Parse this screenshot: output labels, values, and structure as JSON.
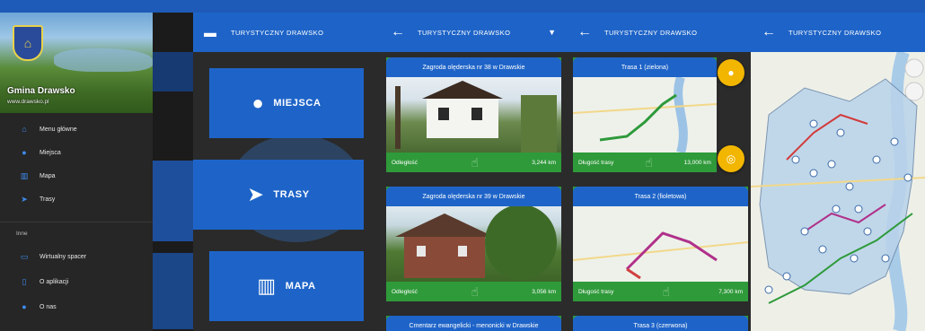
{
  "status_bar": {
    "left": "",
    "right": ""
  },
  "screen1": {
    "drawer": {
      "title": "Gmina Drawsko",
      "subtitle": "www.drawsko.pl",
      "items": [
        {
          "icon": "home-icon",
          "label": "Menu główne"
        },
        {
          "icon": "place-icon",
          "label": "Miejsca"
        },
        {
          "icon": "map-icon",
          "label": "Mapa"
        },
        {
          "icon": "route-icon",
          "label": "Trasy"
        }
      ],
      "section_label": "Inne",
      "other_items": [
        {
          "icon": "cast-icon",
          "label": "Wirtualny spacer"
        },
        {
          "icon": "phone-icon",
          "label": "O aplikacji"
        },
        {
          "icon": "info-icon",
          "label": "O nas"
        }
      ]
    }
  },
  "screen2": {
    "title": "TURYSTYCZNY DRAWSKO",
    "buttons": [
      {
        "icon": "place-icon",
        "label": "MIEJSCA"
      },
      {
        "icon": "navigation-icon",
        "label": "TRASY"
      },
      {
        "icon": "map-icon",
        "label": "MAPA"
      }
    ]
  },
  "screen3": {
    "title": "TURYSTYCZNY DRAWSKO",
    "cards": [
      {
        "title": "Zagroda olęderska nr 38 w Drawskie",
        "foot_label": "Odległość",
        "foot_value": "3,244 km"
      },
      {
        "title": "Zagroda olęderska nr 39 w Drawskie",
        "foot_label": "Odległość",
        "foot_value": "3,056 km"
      },
      {
        "title": "Cmentarz ewangelicki - menonicki w Drawskie"
      }
    ]
  },
  "screen4": {
    "title": "TURYSTYCZNY DRAWSKO",
    "cards": [
      {
        "title": "Trasa 1 (zielona)",
        "foot_label": "Długość trasy",
        "foot_value": "13,000 km"
      },
      {
        "title": "Trasa 2 (fioletowa)",
        "foot_label": "Długość trasy",
        "foot_value": "7,300 km"
      },
      {
        "title": "Trasa 3 (czerwona)"
      }
    ],
    "fab_top": "location-icon",
    "fab_bottom": "target-icon"
  },
  "screen5": {
    "title": "TURYSTYCZNY DRAWSKO"
  },
  "colors": {
    "primary": "#1e64c8",
    "card_foot": "#2f9a3a",
    "fab": "#f2b600",
    "drawer_icon": "#3d8cf0"
  }
}
